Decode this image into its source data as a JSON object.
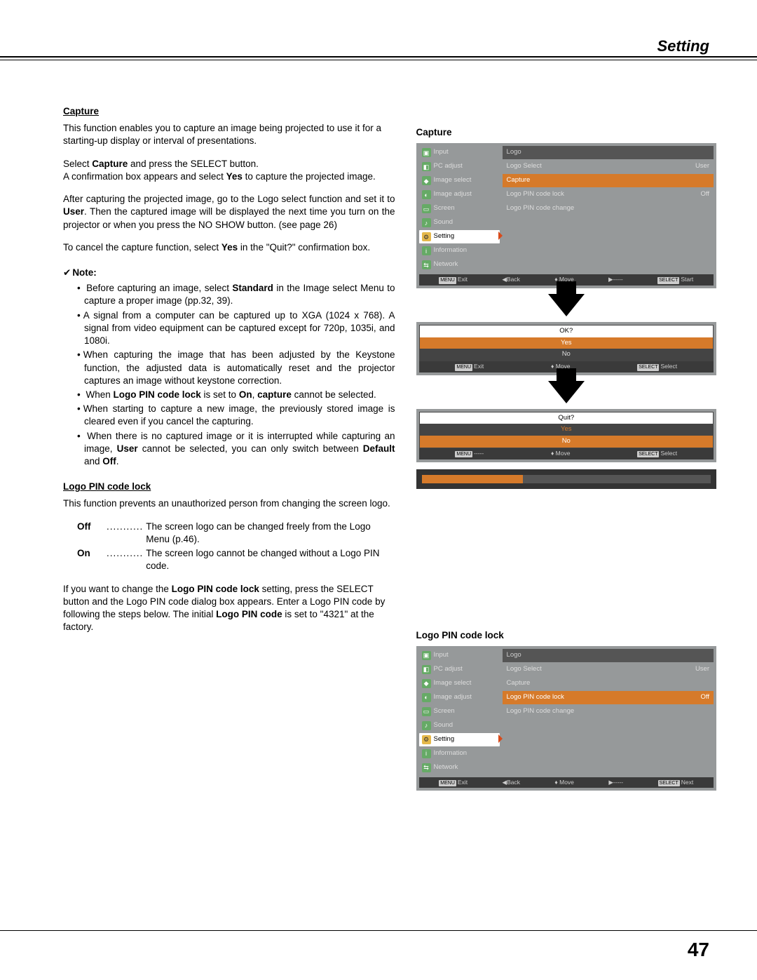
{
  "header": {
    "section": "Setting"
  },
  "page_number": "47",
  "capture": {
    "heading": "Capture",
    "p1": "This function enables you to capture an image being projected to use it for a starting-up display or interval of presentations.",
    "p2_a": "Select ",
    "p2_b": "Capture",
    "p2_c": " and press the SELECT button.",
    "p3_a": "A confirmation box appears and select ",
    "p3_b": "Yes",
    "p3_c": " to capture the projected image.",
    "p4_a": "After capturing the projected image, go to the Logo select function and set it to ",
    "p4_b": "User",
    "p4_c": ". Then the captured image will be displayed the next time you turn on the projector or when you press the NO SHOW button. (see page 26)",
    "p5_a": "To cancel the capture function, select ",
    "p5_b": "Yes",
    "p5_c": " in the \"Quit?\" confirmation box."
  },
  "note": {
    "heading": "Note:",
    "items": [
      {
        "pre": "Before capturing an image, select ",
        "b1": "Standard",
        "post": " in the Image select Menu to capture a proper image (pp.32, 39)."
      },
      {
        "text": "A signal from a computer can be captured up to XGA (1024 x 768). A signal from video equipment can be captured except for 720p, 1035i, and 1080i."
      },
      {
        "text": "When capturing the image that has been adjusted by the Keystone function, the adjusted data is automatically reset and the projector captures an image without keystone correction."
      },
      {
        "pre": "When ",
        "b1": "Logo PIN code lock",
        "mid": " is set to ",
        "b2": "On",
        "mid2": ", ",
        "b3": "capture",
        "post": " cannot be selected."
      },
      {
        "text": "When starting to capture a new image, the previously stored image is cleared even if you cancel the capturing."
      },
      {
        "pre": "When there is no captured image or it is interrupted while capturing an image, ",
        "b1": "User",
        "mid": " cannot be selected, you can only switch between ",
        "b2": "Default",
        "mid2": " and ",
        "b3": "Off",
        "post": "."
      }
    ]
  },
  "pinlock": {
    "heading": "Logo PIN code lock",
    "p1": "This function prevents an unauthorized person from changing the screen logo.",
    "off_label": "Off",
    "off_text": "The screen logo can be changed freely from the Logo Menu (p.46).",
    "on_label": "On",
    "on_text": "The screen logo cannot be changed without a Logo PIN code.",
    "p2_a": "If you want to change the ",
    "p2_b": "Logo PIN code lock",
    "p2_c": " setting, press the SELECT button and the Logo PIN code dialog box appears. Enter a Logo PIN code by following the steps below. The initial ",
    "p2_d": "Logo PIN code",
    "p2_e": " is set to \"4321\" at the factory."
  },
  "right": {
    "capture_heading": "Capture",
    "pinlock_heading": "Logo PIN code lock"
  },
  "osd_menu": {
    "items": [
      "Input",
      "PC adjust",
      "Image select",
      "Image adjust",
      "Screen",
      "Sound",
      "Setting",
      "Information",
      "Network"
    ],
    "panel_head": "Logo",
    "rows": {
      "logo_select": "Logo Select",
      "logo_select_val": "User",
      "capture": "Capture",
      "pin_lock": "Logo PIN code lock",
      "pin_lock_val": "Off",
      "pin_change": "Logo PIN code change"
    },
    "bar1": {
      "exit": "Exit",
      "back": "Back",
      "move": "Move",
      "dash": "-----",
      "start": "Start"
    },
    "bar2": {
      "exit": "Exit",
      "back": "Back",
      "move": "Move",
      "dash": "-----",
      "next": "Next"
    },
    "badge_menu": "MENU",
    "badge_select": "SELECT"
  },
  "dialog_ok": {
    "title": "OK?",
    "yes": "Yes",
    "no": "No",
    "bar": {
      "exit": "Exit",
      "move": "Move",
      "select": "Select"
    }
  },
  "dialog_quit": {
    "title": "Quit?",
    "yes": "Yes",
    "no": "No",
    "bar": {
      "dash": "-----",
      "move": "Move",
      "select": "Select"
    }
  }
}
